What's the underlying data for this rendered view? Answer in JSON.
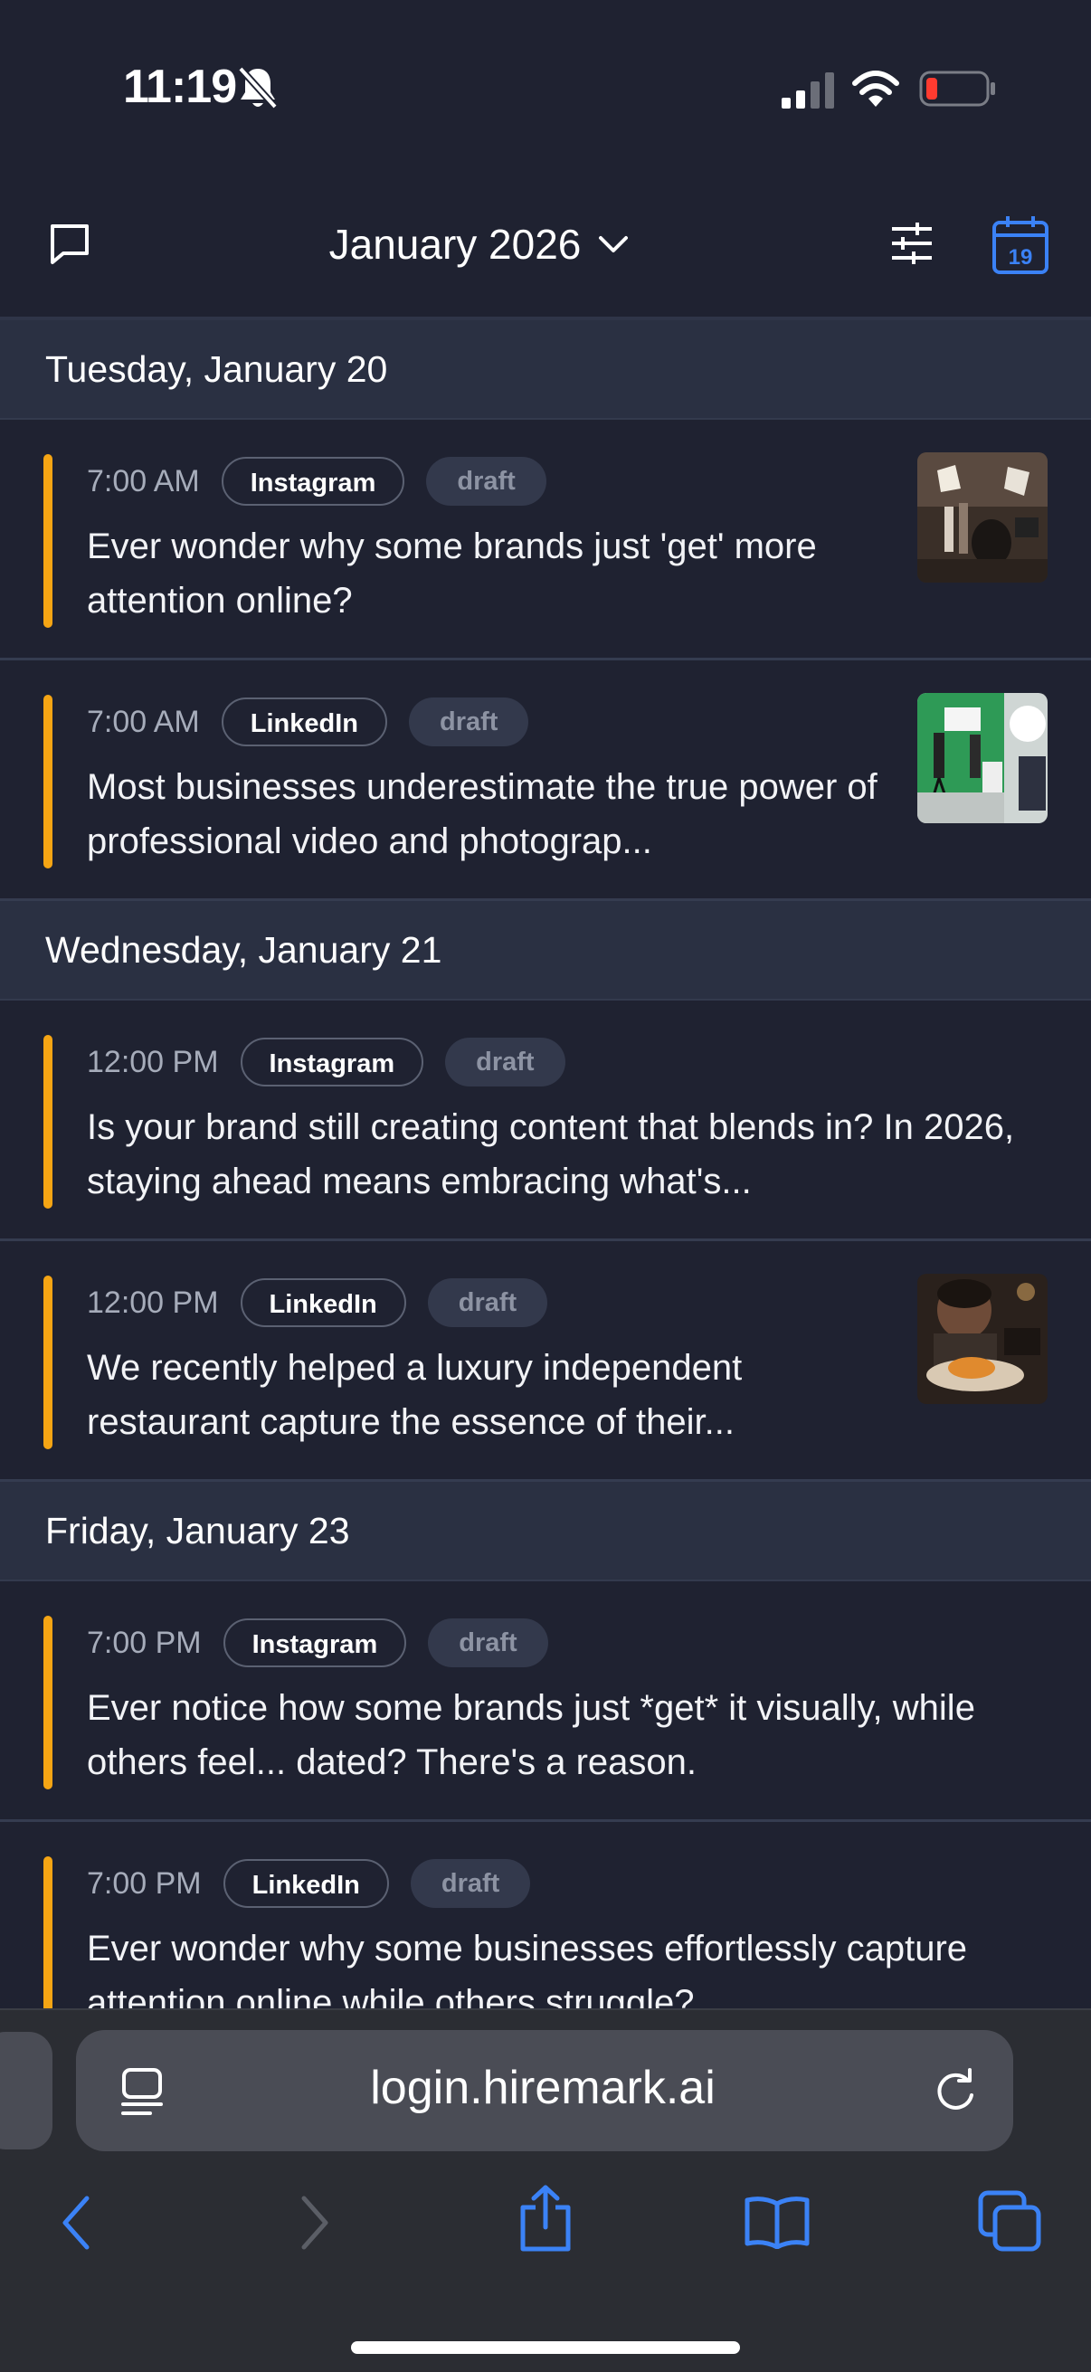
{
  "status_bar": {
    "time": "11:19"
  },
  "header": {
    "month_label": "January 2026"
  },
  "colors": {
    "accent": "#f5a514",
    "blue": "#3b82f6",
    "background": "#1f2231"
  },
  "days": [
    {
      "label": "Tuesday, January 20",
      "posts": [
        {
          "time": "7:00 AM",
          "platform": "Instagram",
          "status": "draft",
          "text": "Ever wonder why some brands just 'get' more attention online?",
          "has_image": true
        },
        {
          "time": "7:00 AM",
          "platform": "LinkedIn",
          "status": "draft",
          "text": "Most businesses underestimate the true power of professional video and photograp...",
          "has_image": true
        }
      ]
    },
    {
      "label": "Wednesday, January 21",
      "posts": [
        {
          "time": "12:00 PM",
          "platform": "Instagram",
          "status": "draft",
          "text": "Is your brand still creating content that blends in? In 2026, staying ahead means embracing what's...",
          "has_image": false
        },
        {
          "time": "12:00 PM",
          "platform": "LinkedIn",
          "status": "draft",
          "text": "We recently helped a luxury independent restaurant capture the essence of their...",
          "has_image": true
        }
      ]
    },
    {
      "label": "Friday, January 23",
      "posts": [
        {
          "time": "7:00 PM",
          "platform": "Instagram",
          "status": "draft",
          "text": "Ever notice how some brands just *get* it visually, while others feel... dated? There's a reason.",
          "has_image": false
        },
        {
          "time": "7:00 PM",
          "platform": "LinkedIn",
          "status": "draft",
          "text": "Ever wonder why some businesses effortlessly capture attention online while others struggle?",
          "has_image": false
        }
      ]
    }
  ],
  "browser": {
    "url": "login.hiremark.ai"
  },
  "icons": [
    "bell-slash-icon",
    "cellular-signal-icon",
    "wifi-icon",
    "battery-low-icon",
    "chat-icon",
    "chevron-down-icon",
    "filter-sliders-icon",
    "calendar-icon",
    "reader-icon",
    "reload-icon",
    "back-icon",
    "forward-icon",
    "share-icon",
    "bookmarks-icon",
    "tabs-icon"
  ],
  "calendar_icon_day": "19"
}
